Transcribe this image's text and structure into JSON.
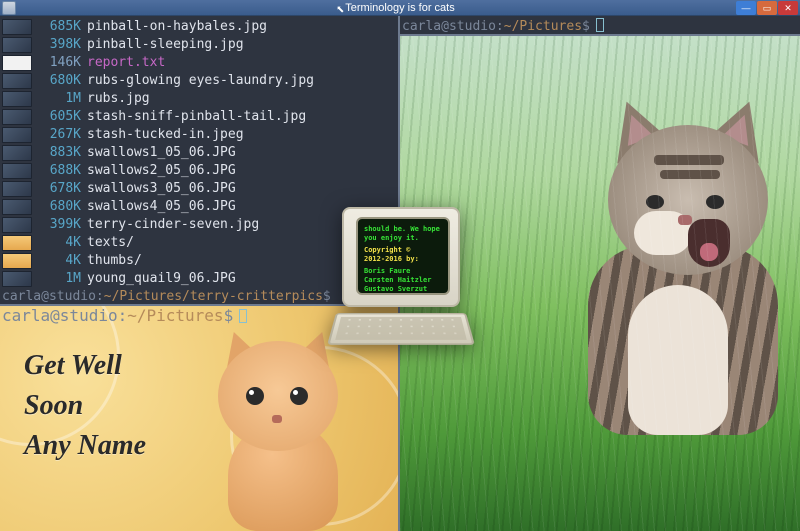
{
  "titlebar": {
    "title": "Terminology is for cats",
    "buttons": {
      "min": "—",
      "max": "▭",
      "close": "✕"
    }
  },
  "left_top_pane": {
    "listing": [
      {
        "size": "685K",
        "name": "pinball-on-haybales.jpg",
        "kind": "img",
        "selected": false
      },
      {
        "size": "398K",
        "name": "pinball-sleeping.jpg",
        "kind": "img",
        "selected": false
      },
      {
        "size": "146K",
        "name": "report.txt",
        "kind": "txt",
        "selected": true
      },
      {
        "size": "680K",
        "name": "rubs-glowing eyes-laundry.jpg",
        "kind": "img",
        "selected": false
      },
      {
        "size": "1M",
        "name": "rubs.jpg",
        "kind": "img",
        "selected": false
      },
      {
        "size": "605K",
        "name": "stash-sniff-pinball-tail.jpg",
        "kind": "img",
        "selected": false
      },
      {
        "size": "267K",
        "name": "stash-tucked-in.jpeg",
        "kind": "img",
        "selected": false
      },
      {
        "size": "883K",
        "name": "swallows1_05_06.JPG",
        "kind": "img",
        "selected": false
      },
      {
        "size": "688K",
        "name": "swallows2_05_06.JPG",
        "kind": "img",
        "selected": false
      },
      {
        "size": "678K",
        "name": "swallows3_05_06.JPG",
        "kind": "img",
        "selected": false
      },
      {
        "size": "680K",
        "name": "swallows4_05_06.JPG",
        "kind": "img",
        "selected": false
      },
      {
        "size": "399K",
        "name": "terry-cinder-seven.jpg",
        "kind": "img",
        "selected": false
      },
      {
        "size": "4K",
        "name": "texts/",
        "kind": "dir",
        "selected": false
      },
      {
        "size": "4K",
        "name": "thumbs/",
        "kind": "dir",
        "selected": false
      },
      {
        "size": "1M",
        "name": "young_quail9_06.JPG",
        "kind": "img",
        "selected": false
      }
    ],
    "prompt": {
      "user": "carla@studio",
      "path": "~/Pictures/terry-critterpics",
      "symbol": "$"
    }
  },
  "left_bottom_prompt": {
    "user": "carla@studio",
    "path": "~/Pictures",
    "symbol": "$"
  },
  "right_prompt": {
    "user": "carla@studio",
    "path": "~/Pictures",
    "symbol": "$"
  },
  "getwell_card": {
    "line1": "Get Well",
    "line2": "Soon",
    "line3": "Any Name"
  },
  "about_splash": {
    "line1": "should be. We hope",
    "line2": "you enjoy it.",
    "copyright": "Copyright ©",
    "years": "2012-2016 by:",
    "authors": [
      "Boris Faure",
      "Carsten Haitzler",
      "Gustavo Sverzut"
    ]
  }
}
